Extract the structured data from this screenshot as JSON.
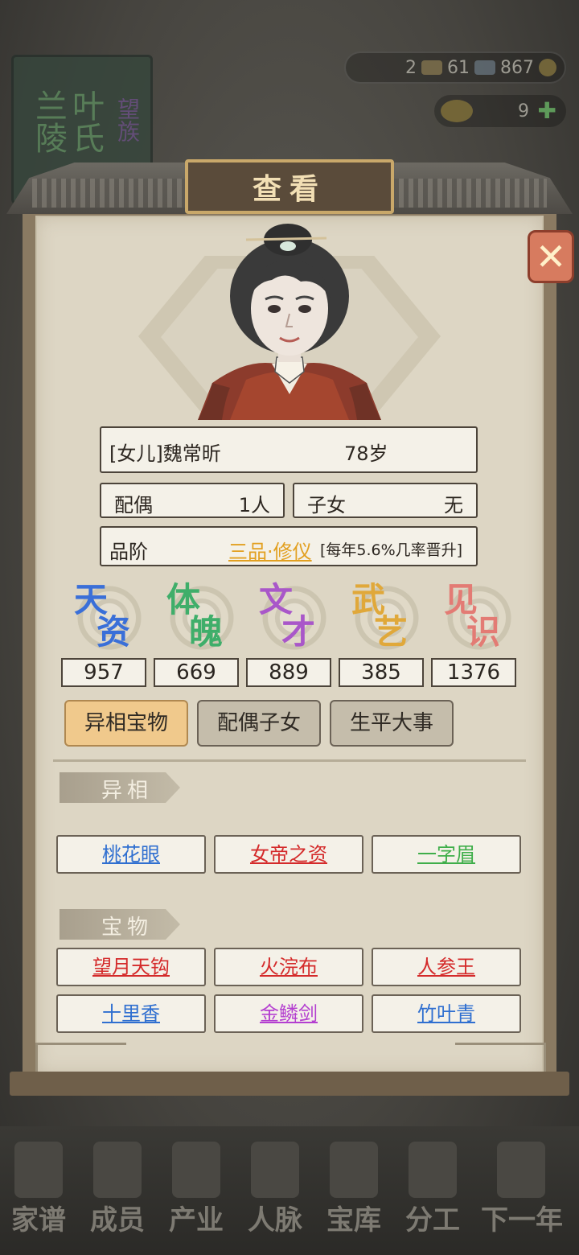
{
  "background": {
    "family_title": [
      "兰陵",
      "叶氏",
      "望族"
    ],
    "currency": {
      "gold": "2",
      "silver": "61",
      "coins": "867"
    },
    "tokens": {
      "count": "9"
    }
  },
  "dialog": {
    "title": "查看",
    "person": {
      "name": "[女儿]魏常昕",
      "age": "78岁",
      "spouse_label": "配偶",
      "spouse_value": "1人",
      "children_label": "子女",
      "children_value": "无",
      "rank_label": "品阶",
      "rank_value": "三品·修仪",
      "rank_note": "[每年5.6%几率晋升]"
    },
    "attributes": [
      {
        "name_top": "天",
        "name_bottom": "资",
        "value": "957",
        "color": "#3a6fd8"
      },
      {
        "name_top": "体",
        "name_bottom": "魄",
        "value": "669",
        "color": "#3fae6a"
      },
      {
        "name_top": "文",
        "name_bottom": "才",
        "value": "889",
        "color": "#a957c9"
      },
      {
        "name_top": "武",
        "name_bottom": "艺",
        "value": "385",
        "color": "#e0a83a"
      },
      {
        "name_top": "见",
        "name_bottom": "识",
        "value": "1376",
        "color": "#e37b74"
      }
    ],
    "tabs": [
      {
        "label": "异相宝物",
        "active": true
      },
      {
        "label": "配偶子女",
        "active": false
      },
      {
        "label": "生平大事",
        "active": false
      }
    ],
    "traits_section": {
      "title": "异相",
      "items": [
        {
          "label": "桃花眼",
          "color": "#2f6fd0"
        },
        {
          "label": "女帝之资",
          "color": "#d42a2a"
        },
        {
          "label": "一字眉",
          "color": "#3fae4a"
        }
      ]
    },
    "treasures_section": {
      "title": "宝物",
      "items": [
        {
          "label": "望月天钩",
          "color": "#d42a2a"
        },
        {
          "label": "火浣布",
          "color": "#d42a2a"
        },
        {
          "label": "人参王",
          "color": "#d42a2a"
        },
        {
          "label": "十里香",
          "color": "#2f6fd0"
        },
        {
          "label": "金鳞剑",
          "color": "#b43fd0"
        },
        {
          "label": "竹叶青",
          "color": "#2f6fd0"
        }
      ]
    }
  },
  "bottom_nav": [
    "家谱",
    "成员",
    "产业",
    "人脉",
    "宝库",
    "分工",
    "下一年"
  ]
}
